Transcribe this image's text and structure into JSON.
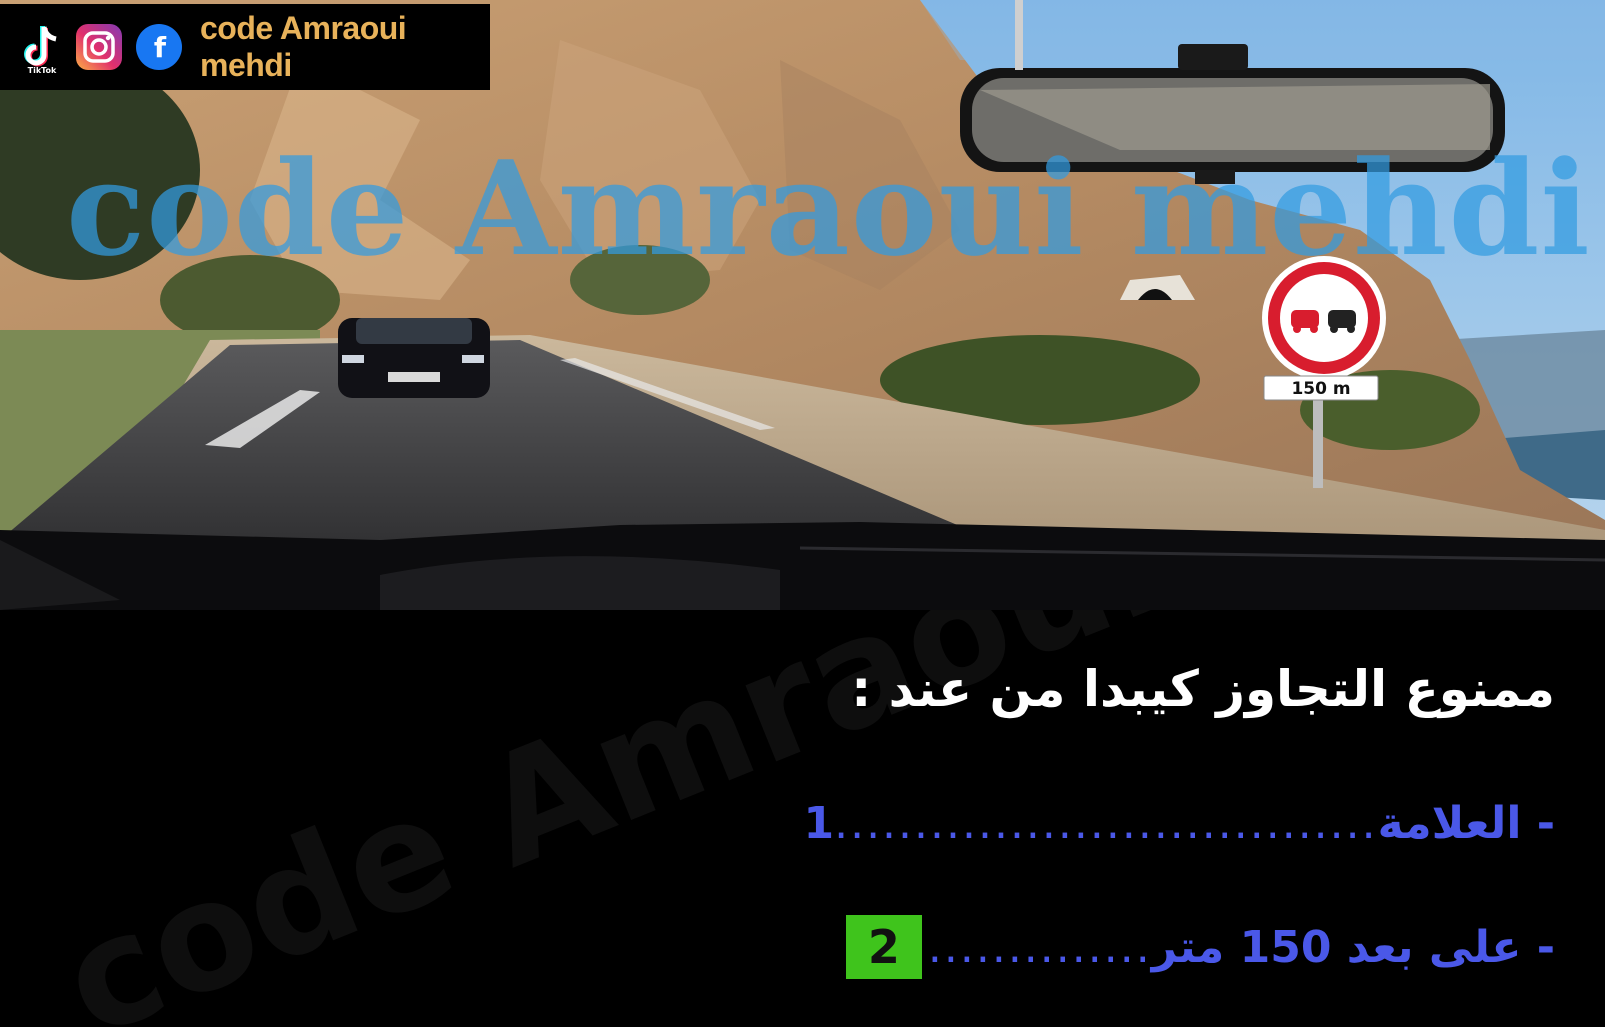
{
  "brand": {
    "name": "code Amraoui mehdi",
    "icons": [
      "tiktok-icon",
      "instagram-icon",
      "facebook-icon"
    ],
    "tiktok_caption": "TikTok",
    "facebook_letter": "f"
  },
  "watermark": "code Amraoui mehdi",
  "scene": {
    "sign_distance": "150 m",
    "sign_type": "no-overtaking"
  },
  "question": {
    "title": "ممنوع التجاوز كيبدا من عند :",
    "answers": [
      {
        "label": "- العلامة",
        "dots": "..................................",
        "number": "1",
        "highlighted": false
      },
      {
        "label": "- على بعد 150 متر",
        "dots": "..............",
        "number": "2",
        "highlighted": true
      }
    ]
  },
  "colors": {
    "brand_text": "#e8b25a",
    "watermark_top": "#329be1",
    "answer_text": "#4a58e8",
    "highlight_box": "#3fc41c",
    "question_text": "#ffffff"
  }
}
